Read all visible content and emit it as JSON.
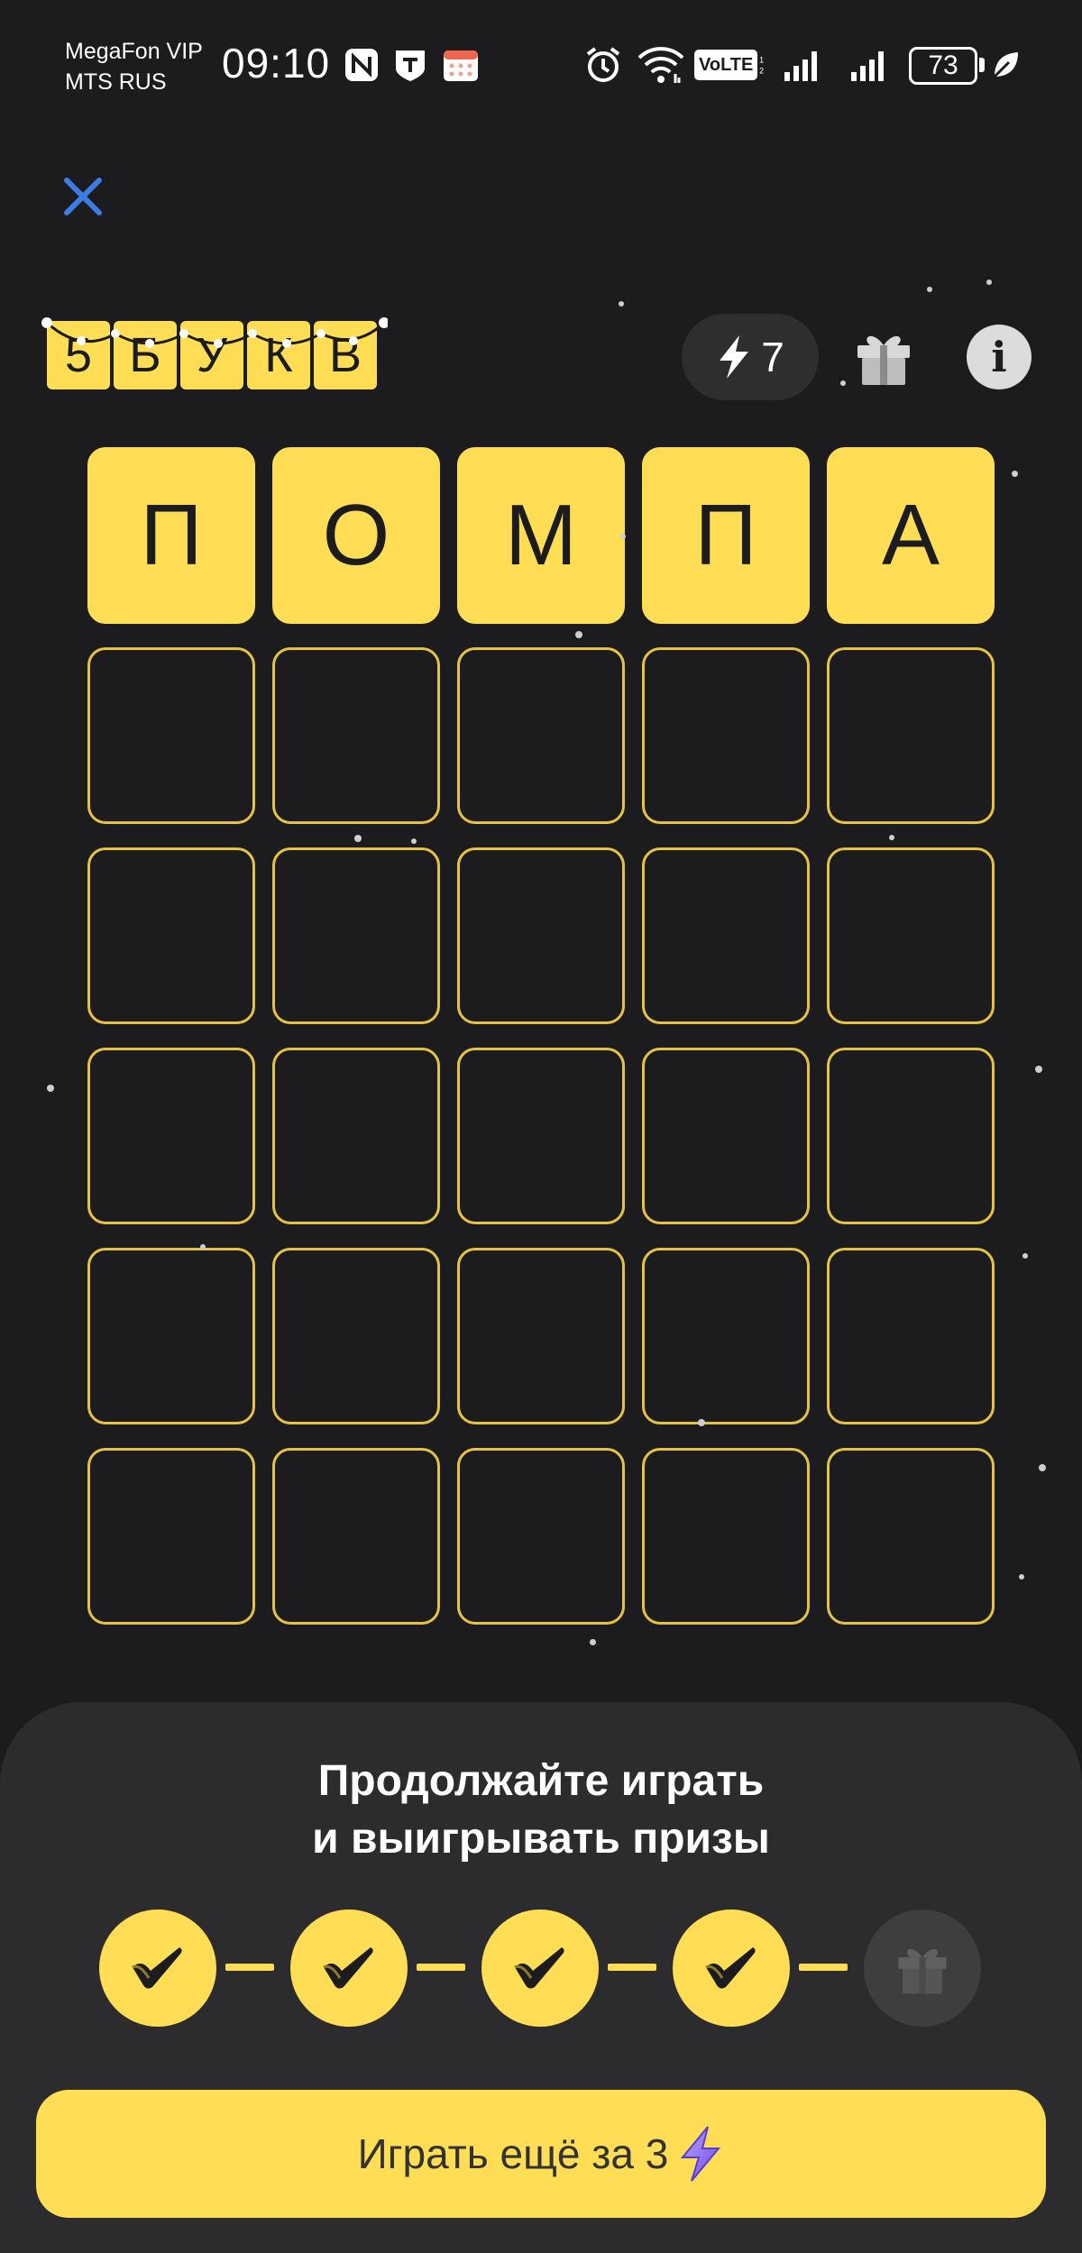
{
  "status_bar": {
    "carrier_1": "MegaFon VIP",
    "carrier_2": "MTS RUS",
    "time": "09:10",
    "volte_label": "VoLTE",
    "battery": "73"
  },
  "logo": {
    "letters": [
      "5",
      "Б",
      "У",
      "К",
      "В"
    ]
  },
  "energy": {
    "count": "7"
  },
  "grid": {
    "rows": [
      [
        "П",
        "О",
        "М",
        "П",
        "А"
      ],
      [
        "",
        "",
        "",
        "",
        ""
      ],
      [
        "",
        "",
        "",
        "",
        ""
      ],
      [
        "",
        "",
        "",
        "",
        ""
      ],
      [
        "",
        "",
        "",
        "",
        ""
      ],
      [
        "",
        "",
        "",
        "",
        ""
      ]
    ]
  },
  "sheet": {
    "title_line_1": "Продолжайте играть",
    "title_line_2": "и выигрывать призы",
    "steps": [
      "done",
      "done",
      "done",
      "done",
      "gift"
    ],
    "play_button": "Играть ещё за 3"
  },
  "colors": {
    "background": "#1c1c1e",
    "accent_yellow": "#ffdd55",
    "cell_border": "#e6c244",
    "sheet": "#2c2c2e",
    "close_blue": "#3d7be6"
  },
  "icons": [
    "nfc-icon",
    "t-icon",
    "calendar-icon",
    "alarm-icon",
    "wifi-icon",
    "volte-icon",
    "signal-icon",
    "battery-icon",
    "leaf-icon",
    "close-icon",
    "lightning-icon",
    "gift-icon",
    "info-icon",
    "check-icon"
  ]
}
